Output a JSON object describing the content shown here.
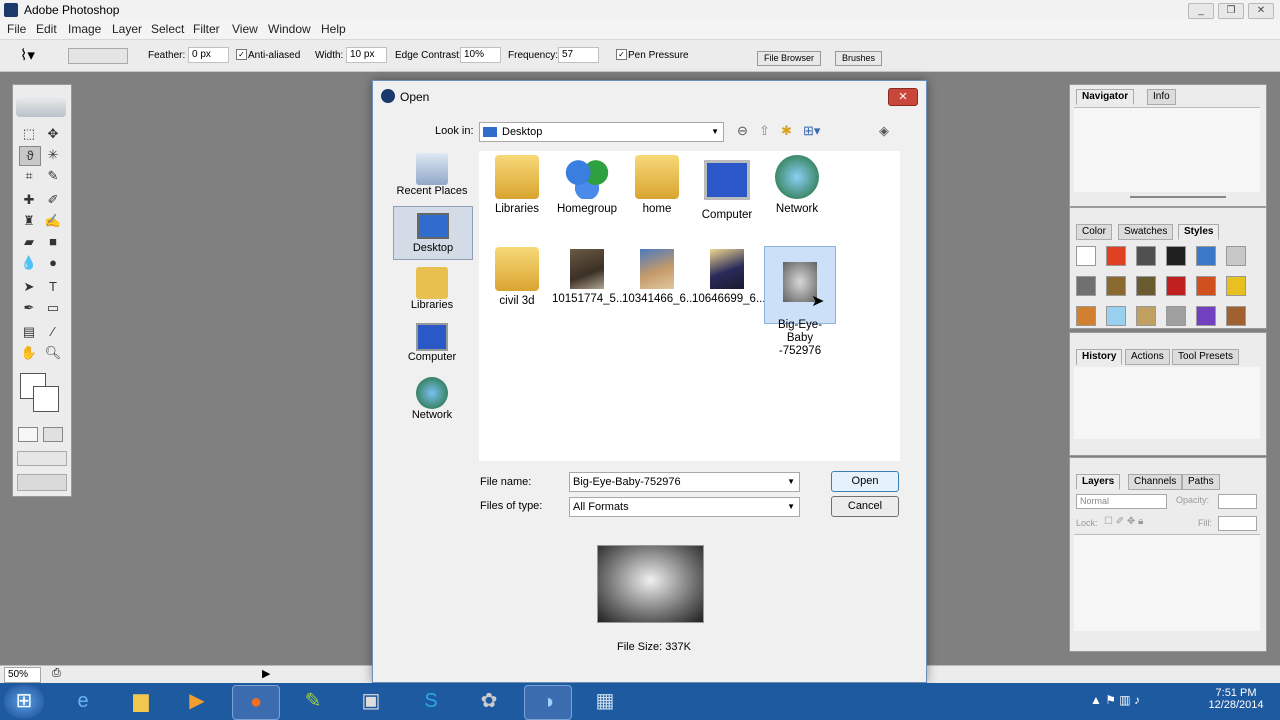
{
  "app": {
    "title": "Adobe Photoshop"
  },
  "window_controls": [
    "_",
    "❐",
    "✕"
  ],
  "menu": [
    "File",
    "Edit",
    "Image",
    "Layer",
    "Select",
    "Filter",
    "View",
    "Window",
    "Help"
  ],
  "options_bar": {
    "feather_label": "Feather:",
    "feather_value": "0 px",
    "anti_aliased_label": "Anti-aliased",
    "width_label": "Width:",
    "width_value": "10 px",
    "edge_contrast_label": "Edge Contrast:",
    "edge_contrast_value": "10%",
    "frequency_label": "Frequency:",
    "frequency_value": "57",
    "pen_pressure_label": "Pen Pressure",
    "tabs": [
      "File Browser",
      "Brushes"
    ]
  },
  "palettes": {
    "navigator_tabs": [
      "Navigator",
      "Info"
    ],
    "styles_tabs": [
      "Color",
      "Swatches",
      "Styles"
    ],
    "history_tabs": [
      "History",
      "Actions",
      "Tool Presets"
    ],
    "layers_tabs": [
      "Layers",
      "Channels",
      "Paths"
    ],
    "blend_mode": "Normal",
    "opacity_label": "Opacity:",
    "lock_label": "Lock:",
    "fill_label": "Fill:",
    "style_colors": [
      "#ffffff",
      "#e04020",
      "#505050",
      "#202020",
      "#3a78c8",
      "#c8c8c8",
      "#707070",
      "#8a6a30",
      "#6a5a30",
      "#c02020",
      "#d05020",
      "#e8c020",
      "#d08030",
      "#9ad0f0",
      "#c0a060",
      "#a0a0a0",
      "#7040c0",
      "#a06030"
    ]
  },
  "dialog": {
    "title": "Open",
    "look_in_label": "Look in:",
    "look_in_value": "Desktop",
    "places": [
      {
        "label": "Recent Places",
        "icon": "recent-places-icon"
      },
      {
        "label": "Desktop",
        "icon": "desktop-icon"
      },
      {
        "label": "Libraries",
        "icon": "libraries-icon"
      },
      {
        "label": "Computer",
        "icon": "computer-icon"
      },
      {
        "label": "Network",
        "icon": "network-icon"
      }
    ],
    "items": [
      {
        "label": "Libraries",
        "icon": "libraries-folder-icon"
      },
      {
        "label": "Homegroup",
        "icon": "homegroup-icon"
      },
      {
        "label": "home",
        "icon": "user-folder-icon"
      },
      {
        "label": "Computer",
        "icon": "computer-icon"
      },
      {
        "label": "Network",
        "icon": "network-icon"
      },
      {
        "label": "civil 3d",
        "icon": "folder-icon"
      },
      {
        "label": "10151774_5...",
        "icon": "photo-thumbnail"
      },
      {
        "label": "10341466_6...",
        "icon": "photo-thumbnail"
      },
      {
        "label": "10646699_6...",
        "icon": "photo-thumbnail"
      },
      {
        "label": "Big-Eye-Baby\n-752976",
        "icon": "photo-thumbnail"
      }
    ],
    "file_name_label": "File name:",
    "file_name_value": "Big-Eye-Baby-752976",
    "files_of_type_label": "Files of type:",
    "files_of_type_value": "All Formats",
    "open_button": "Open",
    "cancel_button": "Cancel",
    "file_size": "File Size: 337K"
  },
  "status": {
    "zoom": "50%"
  },
  "tray": {
    "time": "7:51 PM",
    "date": "12/28/2014"
  }
}
